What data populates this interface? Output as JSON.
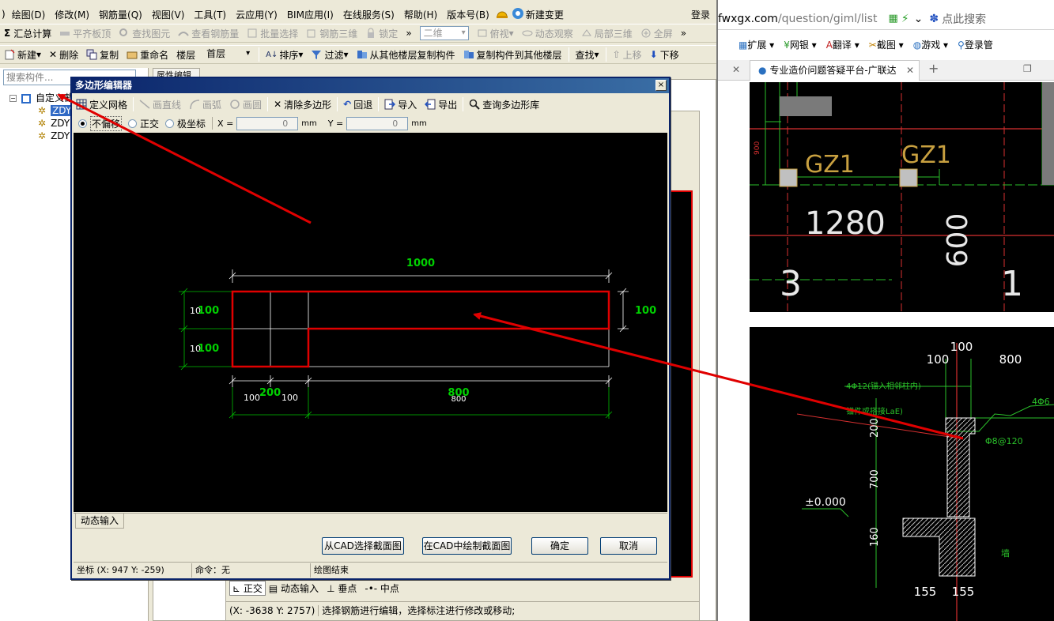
{
  "menu": [
    "绘图(D)",
    "修改(M)",
    "钢筋量(Q)",
    "视图(V)",
    "工具(T)",
    "云应用(Y)",
    "BIM应用(I)",
    "在线服务(S)",
    "帮助(H)",
    "版本号(B)",
    "新建变更",
    "登录"
  ],
  "menu_prefix": ")",
  "toolbar1": [
    "汇总计算",
    "平齐板顶",
    "查找图元",
    "查看钢筋量",
    "批量选择",
    "钢筋三维",
    "锁定",
    "二维",
    "俯视",
    "动态观察",
    "局部三维",
    "全屏"
  ],
  "toolbar2": {
    "new": "新建",
    "delete": "删除",
    "copy": "复制",
    "rename": "重命名",
    "floor_label": "楼层",
    "floor_value": "首层",
    "sort": "排序",
    "filter": "过滤",
    "copy_from": "从其他楼层复制构件",
    "copy_to": "复制构件到其他楼层",
    "find": "查找",
    "up": "上移",
    "down": "下移"
  },
  "left": {
    "search_placeholder": "搜索构件...",
    "tree_root": "自定义截",
    "tree_items": [
      "ZDY",
      "ZDY",
      "ZDY"
    ],
    "prop_tab": "属性编辑"
  },
  "dialog": {
    "title": "多边形编辑器",
    "close": "×",
    "tools": [
      "定义网格",
      "画直线",
      "画弧",
      "画圆",
      "清除多边形",
      "回退",
      "导入",
      "导出",
      "查询多边形库"
    ],
    "opts": {
      "r1": "不偏移",
      "r2": "正交",
      "r3": "极坐标",
      "x_label": "X =",
      "x_val": "0",
      "y_label": "Y =",
      "y_val": "0",
      "unit": "mm"
    },
    "dims": {
      "top": "1000",
      "right": "100",
      "left_top": "100",
      "left_top_w": "10",
      "left_bot": "100",
      "left_bot_w": "10",
      "bot_a": "100",
      "bot_b": "200",
      "bot_c": "100",
      "bot_d": "800",
      "bot_e": "800"
    },
    "dyn_tab": "动态输入",
    "buttons": {
      "cad_select": "从CAD选择截面图",
      "cad_draw": "在CAD中绘制截面图",
      "ok": "确定",
      "cancel": "取消"
    },
    "status": {
      "coord": "坐标 (X: 947 Y: -259)",
      "cmd": "命令：无",
      "msg": "绘图结束"
    }
  },
  "behind": {
    "ortho": "正交",
    "dyn": "动态输入",
    "pt": "垂点",
    "mid": "中点",
    "coord": "(X: -3638 Y: 2757)",
    "msg": "选择钢筋进行编辑，选择标注进行修改或移动;"
  },
  "browser": {
    "url_host": "fwxgx.com",
    "url_path": "/question/giml/list",
    "search_ph": "点此搜索",
    "bookmarks": [
      "扩展",
      "网银",
      "翻译",
      "截图",
      "游戏",
      "登录管"
    ],
    "tab_title": "专业造价问题答疑平台-广联达",
    "cad1": {
      "gz1": "GZ1",
      "gz2": "GZ1",
      "d1280": "1280",
      "d600": "600",
      "d900": "900",
      "n3": "3",
      "n1": "1"
    },
    "cad2": {
      "a": "100",
      "b": "100",
      "c": "800",
      "rebar1": "4Φ12(锚入相邻柱内)",
      "rebar2": "锚件或搭接LaE)",
      "rebar3": "4Φ6",
      "stir": "Φ8@120",
      "h200": "200",
      "h700": "700",
      "h160": "160",
      "lvl": "±0.000",
      "w1": "155",
      "w2": "155",
      "note": "墙"
    }
  },
  "colors": {
    "red": "#e00000",
    "green": "#00d000",
    "cadgreen": "#33cc33",
    "title": "#0a246a",
    "gold": "#c8a040"
  }
}
